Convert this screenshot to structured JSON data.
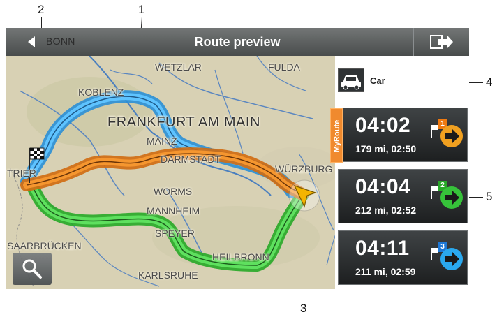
{
  "annotations": {
    "n1": "1",
    "n2": "2",
    "n3": "3",
    "n4": "4",
    "n5": "5"
  },
  "titlebar": {
    "title": "Route preview",
    "back_label": "BONN"
  },
  "map": {
    "cities": {
      "wetzlar": "WETZLAR",
      "fulda": "FULDA",
      "koblenz": "KOBLENZ",
      "frankfurt": "FRANKFURT AM MAIN",
      "mainz": "MAINZ",
      "darmstadt": "DARMSTADT",
      "wurzburg": "WÜRZBURG",
      "trier": "TRIER",
      "worms": "WORMS",
      "mannheim": "MANNHEIM",
      "speyer": "SPEYER",
      "saarbrucken": "SAARBRÜCKEN",
      "heilbronn": "HEILBRONN",
      "karlsruhe": "KARLSRUHE"
    },
    "route_colors": {
      "route1": "#f0892c",
      "route2": "#3ecf3e",
      "route3": "#35aef0"
    }
  },
  "panel": {
    "vehicle": "Car",
    "myroute_tag": "MyRoute",
    "routes": [
      {
        "number": "1",
        "time": "04:02",
        "summary": "179 mi, 02:50",
        "color": "#f0a020"
      },
      {
        "number": "2",
        "time": "04:04",
        "summary": "212 mi, 02:52",
        "color": "#36c23a"
      },
      {
        "number": "3",
        "time": "04:11",
        "summary": "211 mi, 02:59",
        "color": "#2aa8ee"
      }
    ]
  }
}
